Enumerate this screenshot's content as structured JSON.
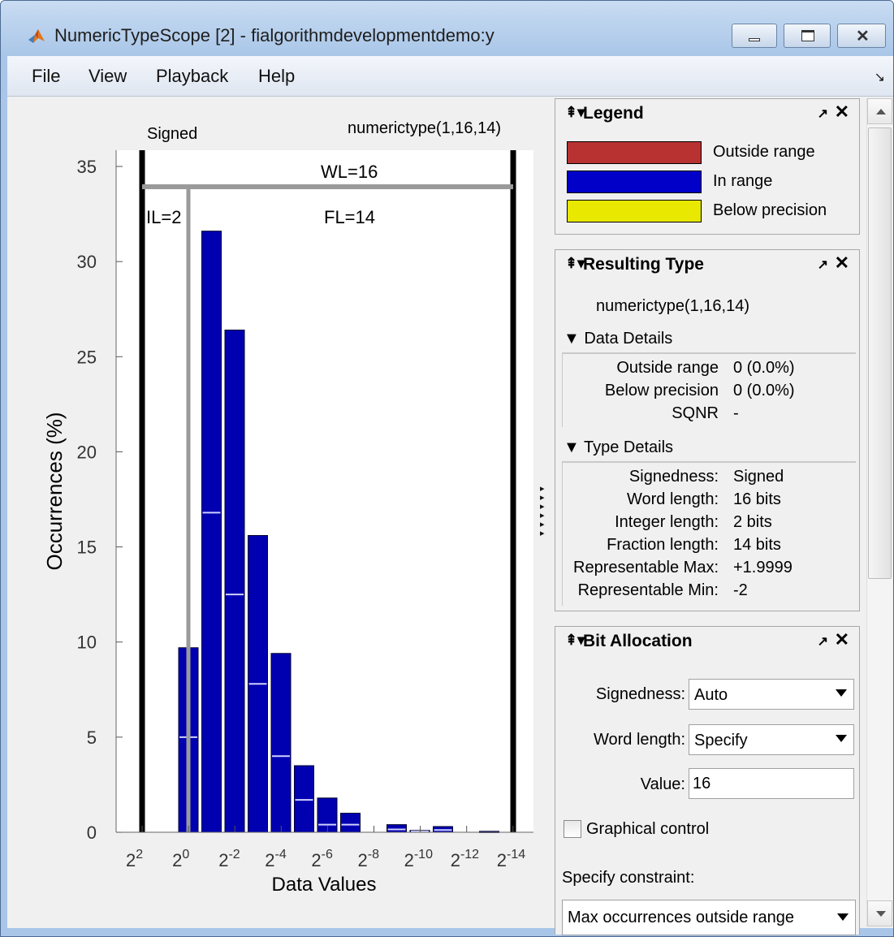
{
  "window": {
    "title": "NumericTypeScope [2] - fialgorithmdevelopmentdemo:y",
    "icon": "matlab-logo-icon"
  },
  "menu": {
    "items": [
      "File",
      "View",
      "Playback",
      "Help"
    ],
    "dock_arrow": "↘"
  },
  "plot": {
    "signed_label": "Signed",
    "type_label": "numerictype(1,16,14)",
    "wl_label": "WL=16",
    "il_label": "IL=2",
    "fl_label": "FL=14"
  },
  "chart_data": {
    "type": "bar",
    "title": "",
    "xlabel": "Data Values",
    "ylabel": "Occurrences (%)",
    "ylim": [
      0,
      35
    ],
    "ytick_labels": [
      "0",
      "5",
      "10",
      "15",
      "20",
      "25",
      "30",
      "35"
    ],
    "xtick_exponents": [
      "2",
      "0",
      "-2",
      "-4",
      "-6",
      "-8",
      "-10",
      "-12",
      "-14"
    ],
    "xtick_base": "2",
    "categories": [
      "2^0",
      "2^-1",
      "2^-2",
      "2^-3",
      "2^-4",
      "2^-5",
      "2^-6",
      "2^-7",
      "2^-8",
      "2^-9",
      "2^-10",
      "2^-11",
      "2^-12",
      "2^-13"
    ],
    "values": [
      9.7,
      31.6,
      26.4,
      15.6,
      9.4,
      3.5,
      1.8,
      1.0,
      0.0,
      0.4,
      0.1,
      0.3,
      0.0,
      0.05
    ],
    "cumulative_markers": [
      5.0,
      16.8,
      12.5,
      7.8,
      4.0,
      1.7,
      0.4,
      0.4,
      null,
      0.15,
      0.05,
      0.12,
      null,
      null
    ],
    "series_color": "#0000b0",
    "grid": false
  },
  "legend_panel": {
    "title": "Legend",
    "items": [
      {
        "label": "Outside range",
        "color": "#b83232"
      },
      {
        "label": "In range",
        "color": "#0000c8"
      },
      {
        "label": "Below precision",
        "color": "#e8e800"
      }
    ]
  },
  "type_panel": {
    "title": "Resulting Type",
    "type_string": "numerictype(1,16,14)",
    "data_details": {
      "header": "Data Details",
      "rows": [
        {
          "label": "Outside range",
          "value": "0 (0.0%)"
        },
        {
          "label": "Below precision",
          "value": "0 (0.0%)"
        },
        {
          "label": "SQNR",
          "value": "-"
        }
      ]
    },
    "type_details": {
      "header": "Type Details",
      "rows": [
        {
          "label": "Signedness:",
          "value": "Signed"
        },
        {
          "label": "Word length:",
          "value": "16 bits"
        },
        {
          "label": "Integer length:",
          "value": "2 bits"
        },
        {
          "label": "Fraction length:",
          "value": "14 bits"
        },
        {
          "label": "Representable Max:",
          "value": "+1.9999"
        },
        {
          "label": "Representable Min:",
          "value": "-2"
        }
      ]
    }
  },
  "bits_panel": {
    "title": "Bit Allocation",
    "signedness_label": "Signedness:",
    "signedness_value": "Auto",
    "word_length_label": "Word length:",
    "word_length_value": "Specify",
    "value_label": "Value:",
    "value": "16",
    "graphical_control_label": "Graphical control",
    "graphical_control_checked": false,
    "constraint_label": "Specify constraint:",
    "constraint_value": "Max occurrences outside range"
  }
}
